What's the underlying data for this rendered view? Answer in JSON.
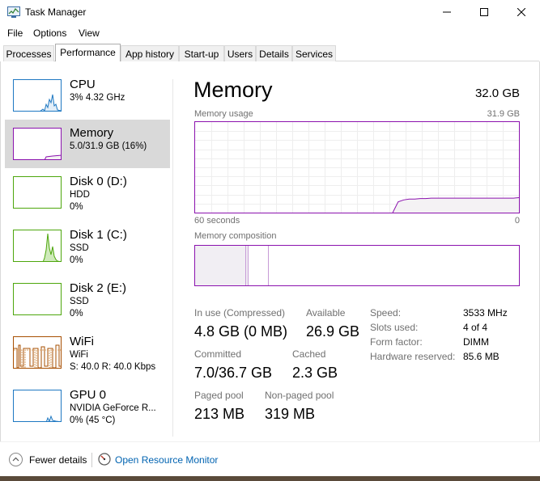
{
  "window": {
    "title": "Task Manager",
    "controls": [
      "minimize",
      "maximize",
      "close"
    ]
  },
  "menu": [
    "File",
    "Options",
    "View"
  ],
  "tabs": [
    "Processes",
    "Performance",
    "App history",
    "Start-up",
    "Users",
    "Details",
    "Services"
  ],
  "active_tab": "Performance",
  "sidebar": [
    {
      "title": "CPU",
      "line2": "3%  4.32 GHz",
      "line3": "",
      "color": "#1e78c2"
    },
    {
      "title": "Memory",
      "line2": "5.0/31.9 GB (16%)",
      "line3": "",
      "color": "#8b12ae"
    },
    {
      "title": "Disk 0 (D:)",
      "line2": "HDD",
      "line3": "0%",
      "color": "#4da60c"
    },
    {
      "title": "Disk 1 (C:)",
      "line2": "SSD",
      "line3": "0%",
      "color": "#4da60c"
    },
    {
      "title": "Disk 2 (E:)",
      "line2": "SSD",
      "line3": "0%",
      "color": "#4da60c"
    },
    {
      "title": "WiFi",
      "line2": "WiFi",
      "line3": "S: 40.0  R: 40.0 Kbps",
      "color": "#a74f01"
    },
    {
      "title": "GPU 0",
      "line2": "NVIDIA GeForce R...",
      "line3": "0%  (45 °C)",
      "color": "#1e78c2"
    }
  ],
  "selected_item": "Memory",
  "memory": {
    "title": "Memory",
    "total": "32.0 GB",
    "usage_label": "Memory usage",
    "usage_max": "31.9 GB",
    "time_left": "60 seconds",
    "time_right": "0",
    "composition_label": "Memory composition",
    "usage_history_pct": [
      0,
      0,
      0,
      0,
      0,
      0,
      0,
      0,
      0,
      0,
      0,
      0,
      0,
      0,
      0,
      0,
      0,
      0,
      0,
      0,
      0,
      0,
      0,
      0,
      0,
      0,
      0,
      0,
      0,
      0,
      0,
      0,
      0,
      0,
      0,
      0,
      0,
      12,
      14,
      15,
      15,
      15.5,
      15.5,
      16,
      16,
      16,
      16,
      16,
      16,
      16,
      16,
      16,
      16,
      16,
      16,
      16,
      16,
      16,
      16,
      16.5
    ],
    "in_use_label": "In use (Compressed)",
    "in_use_value": "4.8 GB (0 MB)",
    "available_label": "Available",
    "available_value": "26.9 GB",
    "committed_label": "Committed",
    "committed_value": "7.0/36.7 GB",
    "cached_label": "Cached",
    "cached_value": "2.3 GB",
    "paged_label": "Paged pool",
    "paged_value": "213 MB",
    "nonpaged_label": "Non-paged pool",
    "nonpaged_value": "319 MB",
    "details": [
      {
        "label": "Speed:",
        "value": "3533 MHz"
      },
      {
        "label": "Slots used:",
        "value": "4 of 4"
      },
      {
        "label": "Form factor:",
        "value": "DIMM"
      },
      {
        "label": "Hardware reserved:",
        "value": "85.6 MB"
      }
    ]
  },
  "footer": {
    "fewer_details": "Fewer details",
    "resource_monitor": "Open Resource Monitor"
  },
  "colors": {
    "memory": "#8b12ae",
    "memory_fill": "#f4f2f4",
    "grid": "#eeeeee",
    "link": "#0063b1"
  }
}
